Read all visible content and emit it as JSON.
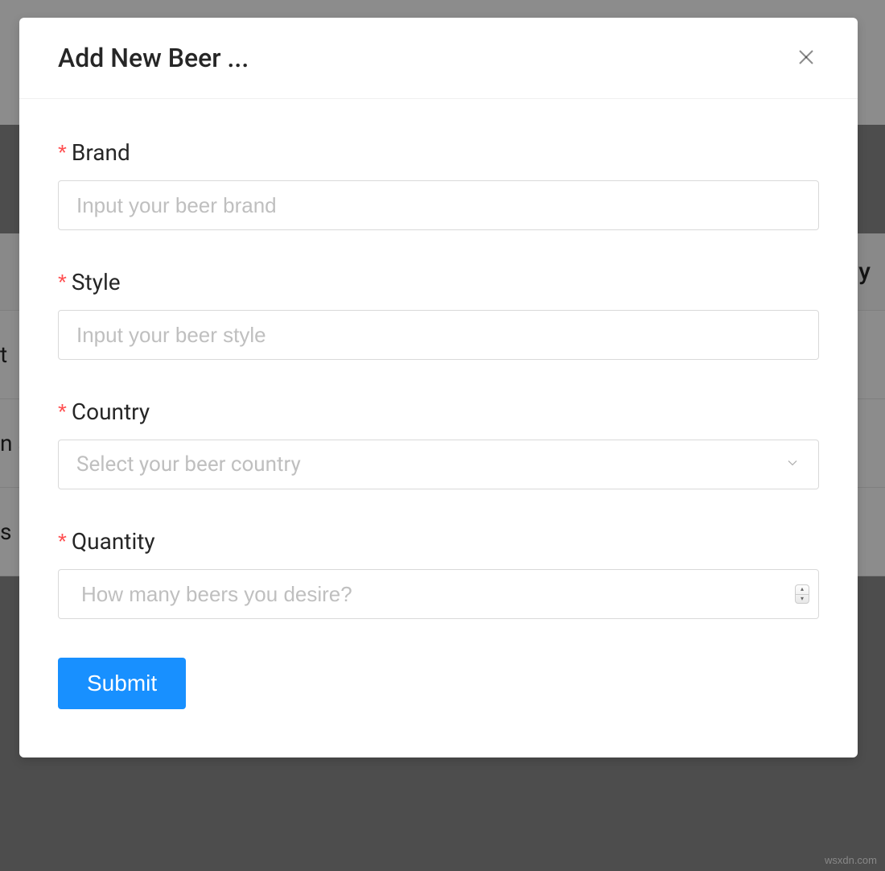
{
  "modal": {
    "title": "Add New Beer ...",
    "close_label": "Close"
  },
  "form": {
    "required_mark": "*",
    "brand": {
      "label": "Brand",
      "placeholder": "Input your beer brand"
    },
    "style": {
      "label": "Style",
      "placeholder": "Input your beer style"
    },
    "country": {
      "label": "Country",
      "placeholder": "Select your beer country"
    },
    "quantity": {
      "label": "Quantity",
      "placeholder": "How many beers you desire?"
    },
    "submit_label": "Submit"
  },
  "background": {
    "header_col": "y",
    "row1": "t",
    "row2": "n a",
    "row3": "s"
  },
  "watermark": "wsxdn.com"
}
